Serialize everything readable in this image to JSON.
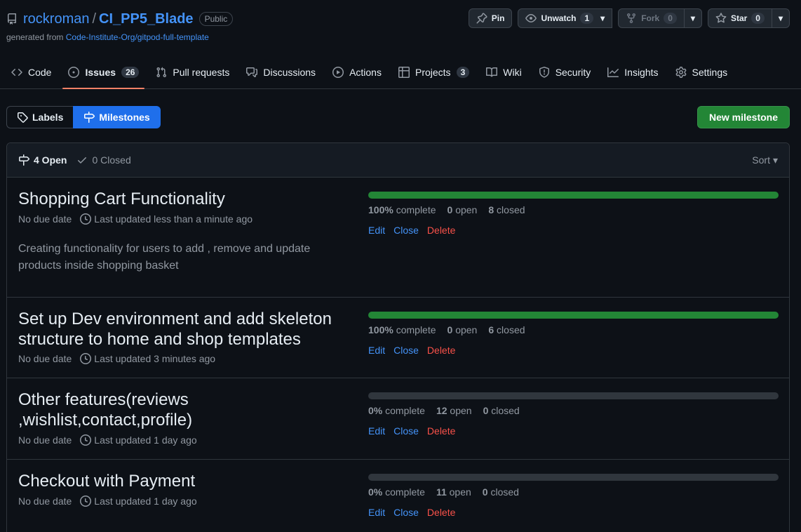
{
  "repo": {
    "owner": "rockroman",
    "separator": "/",
    "name": "CI_PP5_Blade",
    "visibility": "Public",
    "generated_prefix": "generated from",
    "generated_link": "Code-Institute-Org/gitpod-full-template"
  },
  "head_actions": {
    "pin": "Pin",
    "unwatch": "Unwatch",
    "unwatch_count": "1",
    "fork": "Fork",
    "fork_count": "0",
    "star": "Star",
    "star_count": "0"
  },
  "tabs": [
    {
      "label": "Code",
      "icon": "code-icon"
    },
    {
      "label": "Issues",
      "icon": "issue-icon",
      "count": "26"
    },
    {
      "label": "Pull requests",
      "icon": "pull-request-icon"
    },
    {
      "label": "Discussions",
      "icon": "discussions-icon"
    },
    {
      "label": "Actions",
      "icon": "play-icon"
    },
    {
      "label": "Projects",
      "icon": "table-icon",
      "count": "3"
    },
    {
      "label": "Wiki",
      "icon": "book-icon"
    },
    {
      "label": "Security",
      "icon": "shield-icon"
    },
    {
      "label": "Insights",
      "icon": "graph-icon"
    },
    {
      "label": "Settings",
      "icon": "gear-icon"
    }
  ],
  "subnav": {
    "labels": "Labels",
    "milestones": "Milestones"
  },
  "new_milestone": "New milestone",
  "box_header": {
    "open": "4 Open",
    "closed": "0 Closed",
    "sort": "Sort"
  },
  "colors": {
    "accent": "#4493f8",
    "success": "#238636",
    "danger": "#f85149",
    "tab_underline": "#f78166"
  },
  "milestones": [
    {
      "title": "Shopping Cart Functionality",
      "due": "No due date",
      "updated": "Last updated less than a minute ago",
      "description": "Creating functionality for users to add , remove and update products inside shopping basket",
      "progress": 1.0,
      "percent": "100%",
      "complete_label": "complete",
      "open_count": "0",
      "open_label": "open",
      "closed_count": "8",
      "closed_label": "closed",
      "edit": "Edit",
      "close": "Close",
      "delete": "Delete"
    },
    {
      "title": "Set up Dev environment and add skeleton structure to home and shop templates",
      "due": "No due date",
      "updated": "Last updated 3 minutes ago",
      "description": "",
      "progress": 1.0,
      "percent": "100%",
      "complete_label": "complete",
      "open_count": "0",
      "open_label": "open",
      "closed_count": "6",
      "closed_label": "closed",
      "edit": "Edit",
      "close": "Close",
      "delete": "Delete"
    },
    {
      "title": "Other features(reviews ,wishlist,contact,profile)",
      "due": "No due date",
      "updated": "Last updated 1 day ago",
      "description": "",
      "progress": 0.0,
      "percent": "0%",
      "complete_label": "complete",
      "open_count": "12",
      "open_label": "open",
      "closed_count": "0",
      "closed_label": "closed",
      "edit": "Edit",
      "close": "Close",
      "delete": "Delete"
    },
    {
      "title": "Checkout with Payment",
      "due": "No due date",
      "updated": "Last updated 1 day ago",
      "description": "",
      "progress": 0.0,
      "percent": "0%",
      "complete_label": "complete",
      "open_count": "11",
      "open_label": "open",
      "closed_count": "0",
      "closed_label": "closed",
      "edit": "Edit",
      "close": "Close",
      "delete": "Delete"
    }
  ]
}
